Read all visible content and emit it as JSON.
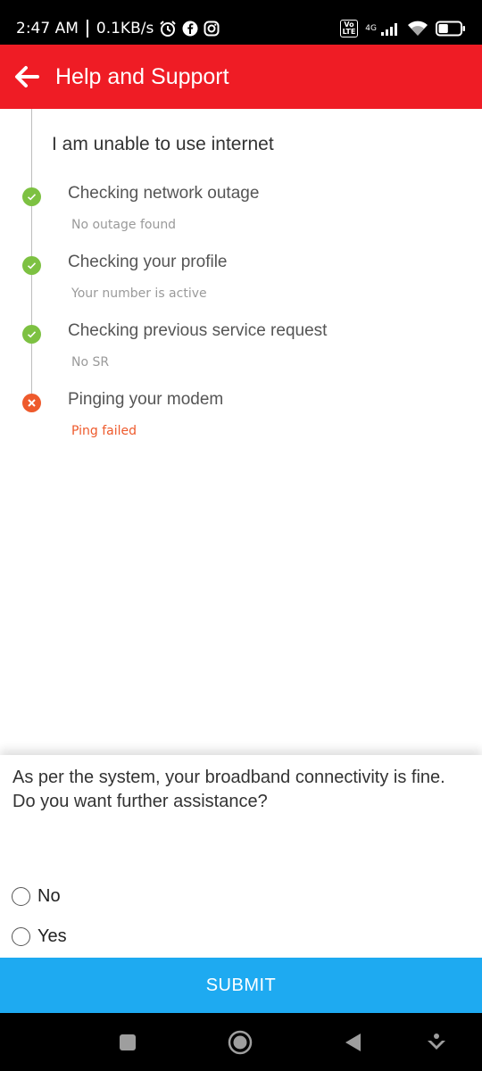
{
  "status_bar": {
    "time": "2:47 AM",
    "speed": "0.1KB/s",
    "icons": [
      "alarm-icon",
      "facebook-icon",
      "instagram-icon"
    ],
    "volte_label": "Vo\nLTE",
    "network_label": "4G",
    "right_icons": [
      "volte-icon",
      "signal-icon",
      "wifi-icon",
      "battery-icon"
    ],
    "battery_level": 0.45
  },
  "app_bar": {
    "title": "Help and Support",
    "back_icon": "arrow-left-icon",
    "color": "#ef1c25"
  },
  "diagnostics": {
    "issue_title": "I am unable to use internet",
    "steps": [
      {
        "label": "Checking network outage",
        "detail": "No outage found",
        "status": "success"
      },
      {
        "label": "Checking your profile",
        "detail": "Your number is active",
        "status": "success"
      },
      {
        "label": "Checking previous service request",
        "detail": "No SR",
        "status": "success"
      },
      {
        "label": "Pinging your modem",
        "detail": "Ping failed",
        "status": "failed"
      }
    ],
    "colors": {
      "success": "#7dc142",
      "failed": "#ee5a2c"
    }
  },
  "feedback": {
    "question": "As per the system, your broadband connectivity is fine. Do you want further assistance?",
    "options": [
      {
        "label": "No",
        "selected": false
      },
      {
        "label": "Yes",
        "selected": false
      }
    ],
    "submit_label": "SUBMIT",
    "submit_color": "#1eaaf1"
  },
  "nav_bar": {
    "buttons": [
      "recents-square-icon",
      "home-circle-icon",
      "back-triangle-icon",
      "assistant-icon"
    ]
  }
}
